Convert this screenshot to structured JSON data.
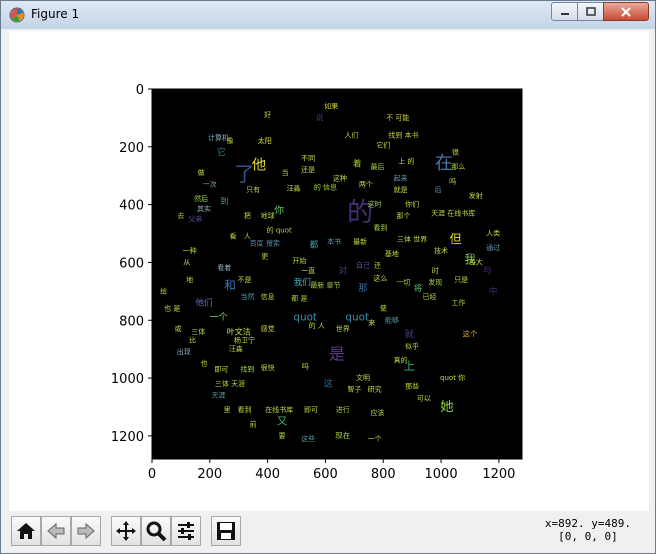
{
  "window": {
    "title": "Figure 1"
  },
  "toolbar": {
    "home": "home-icon",
    "back": "back-icon",
    "forward": "forward-icon",
    "pan": "pan-icon",
    "zoom": "zoom-icon",
    "configure": "configure-subplots-icon",
    "save": "save-icon",
    "coords_line1": "x=892. y=489.",
    "coords_line2": "[0, 0, 0]"
  },
  "chart_data": {
    "type": "wordcloud-image",
    "xlim": [
      0,
      1280
    ],
    "ylim": [
      1280,
      0
    ],
    "xticks": [
      0,
      200,
      400,
      600,
      800,
      1000,
      1200
    ],
    "yticks": [
      0,
      200,
      400,
      600,
      800,
      1000,
      1200
    ],
    "background": "#000000",
    "words": [
      {
        "t": "的",
        "x": 720,
        "y": 430,
        "s": 90,
        "c": "#44307a"
      },
      {
        "t": "了",
        "x": 320,
        "y": 300,
        "s": 70,
        "c": "#3b528b"
      },
      {
        "t": "在",
        "x": 1010,
        "y": 260,
        "s": 62,
        "c": "#4a78a4"
      },
      {
        "t": "他",
        "x": 370,
        "y": 265,
        "s": 50,
        "c": "#e0d82a"
      },
      {
        "t": "是",
        "x": 640,
        "y": 920,
        "s": 55,
        "c": "#5a3c8c"
      },
      {
        "t": "quot",
        "x": 530,
        "y": 790,
        "s": 36,
        "c": "#3c8fa8"
      },
      {
        "t": "quot",
        "x": 710,
        "y": 790,
        "s": 36,
        "c": "#3c8fa8"
      },
      {
        "t": "她",
        "x": 1020,
        "y": 1100,
        "s": 46,
        "c": "#8fd445"
      },
      {
        "t": "但",
        "x": 1050,
        "y": 520,
        "s": 42,
        "c": "#e0e020"
      },
      {
        "t": "你",
        "x": 440,
        "y": 420,
        "s": 34,
        "c": "#66c060"
      },
      {
        "t": "我",
        "x": 1100,
        "y": 590,
        "s": 40,
        "c": "#6ece58"
      },
      {
        "t": "我们",
        "x": 520,
        "y": 670,
        "s": 30,
        "c": "#4fa8c0"
      },
      {
        "t": "和",
        "x": 270,
        "y": 680,
        "s": 40,
        "c": "#3b7abf"
      },
      {
        "t": "他们",
        "x": 180,
        "y": 740,
        "s": 30,
        "c": "#5b6ec0"
      },
      {
        "t": "一个",
        "x": 230,
        "y": 790,
        "s": 32,
        "c": "#7bd060"
      },
      {
        "t": "叶文洁",
        "x": 300,
        "y": 840,
        "s": 28,
        "c": "#c8e030"
      },
      {
        "t": "着",
        "x": 710,
        "y": 260,
        "s": 30,
        "c": "#a8d838"
      },
      {
        "t": "说",
        "x": 580,
        "y": 100,
        "s": 26,
        "c": "#5c2f8a"
      },
      {
        "t": "就",
        "x": 890,
        "y": 850,
        "s": 34,
        "c": "#4b3d8a"
      },
      {
        "t": "将",
        "x": 920,
        "y": 690,
        "s": 30,
        "c": "#4fc070"
      },
      {
        "t": "都",
        "x": 560,
        "y": 540,
        "s": 30,
        "c": "#4d9ab8"
      },
      {
        "t": "对",
        "x": 660,
        "y": 630,
        "s": 30,
        "c": "#413e8a"
      },
      {
        "t": "那",
        "x": 730,
        "y": 690,
        "s": 32,
        "c": "#3a6fa0"
      },
      {
        "t": "这",
        "x": 610,
        "y": 1020,
        "s": 32,
        "c": "#2e6f8e"
      },
      {
        "t": "上",
        "x": 890,
        "y": 960,
        "s": 40,
        "c": "#27ad81"
      },
      {
        "t": "又",
        "x": 450,
        "y": 1150,
        "s": 36,
        "c": "#4fae70"
      },
      {
        "t": "它",
        "x": 240,
        "y": 220,
        "s": 32,
        "c": "#26828e"
      },
      {
        "t": "到",
        "x": 250,
        "y": 390,
        "s": 28,
        "c": "#5b9ab0"
      },
      {
        "t": "中",
        "x": 1180,
        "y": 700,
        "s": 30,
        "c": "#4a2c7a"
      },
      {
        "t": "与",
        "x": 1160,
        "y": 630,
        "s": 32,
        "c": "#482a78"
      },
      {
        "t": "这个",
        "x": 1100,
        "y": 850,
        "s": 26,
        "c": "#e0b020"
      },
      {
        "t": "现在",
        "x": 660,
        "y": 1200,
        "s": 26,
        "c": "#b0d848"
      },
      {
        "t": "太阳",
        "x": 390,
        "y": 180,
        "s": 22,
        "c": "#e0e040"
      },
      {
        "t": "汪淼",
        "x": 490,
        "y": 345,
        "s": 22,
        "c": "#c8e040"
      },
      {
        "t": "如果",
        "x": 620,
        "y": 60,
        "s": 18,
        "c": "#d0d040"
      },
      {
        "t": "不 可能",
        "x": 850,
        "y": 100,
        "s": 18,
        "c": "#d0d040"
      },
      {
        "t": "好",
        "x": 400,
        "y": 90,
        "s": 18,
        "c": "#aad840"
      },
      {
        "t": "人们",
        "x": 690,
        "y": 160,
        "s": 18,
        "c": "#d0d040"
      },
      {
        "t": "找到 本书",
        "x": 870,
        "y": 160,
        "s": 18,
        "c": "#d0d040"
      },
      {
        "t": "很",
        "x": 1050,
        "y": 220,
        "s": 22,
        "c": "#c8d840"
      },
      {
        "t": "计算机",
        "x": 230,
        "y": 170,
        "s": 18,
        "c": "#8ab0c0"
      },
      {
        "t": "做",
        "x": 170,
        "y": 290,
        "s": 20,
        "c": "#c8d840"
      },
      {
        "t": "一次",
        "x": 200,
        "y": 330,
        "s": 18,
        "c": "#8ab0c0"
      },
      {
        "t": "然后",
        "x": 170,
        "y": 380,
        "s": 18,
        "c": "#aad840"
      },
      {
        "t": "其实",
        "x": 180,
        "y": 415,
        "s": 18,
        "c": "#8ab0c0"
      },
      {
        "t": "父亲",
        "x": 150,
        "y": 450,
        "s": 18,
        "c": "#5a4a9a"
      },
      {
        "t": "把",
        "x": 330,
        "y": 440,
        "s": 20,
        "c": "#d8d840"
      },
      {
        "t": "地球",
        "x": 400,
        "y": 440,
        "s": 18,
        "c": "#aad840"
      },
      {
        "t": "看",
        "x": 280,
        "y": 510,
        "s": 20,
        "c": "#c8d840"
      },
      {
        "t": "百度 搜索",
        "x": 390,
        "y": 535,
        "s": 18,
        "c": "#5a8aaa"
      },
      {
        "t": "一种",
        "x": 130,
        "y": 560,
        "s": 18,
        "c": "#aad840"
      },
      {
        "t": "更",
        "x": 390,
        "y": 580,
        "s": 18,
        "c": "#aad840"
      },
      {
        "t": "开始",
        "x": 510,
        "y": 595,
        "s": 18,
        "c": "#aad840"
      },
      {
        "t": "看着",
        "x": 250,
        "y": 620,
        "s": 18,
        "c": "#8ab0c0"
      },
      {
        "t": "一直",
        "x": 540,
        "y": 630,
        "s": 18,
        "c": "#c8d840"
      },
      {
        "t": "不是",
        "x": 320,
        "y": 660,
        "s": 20,
        "c": "#c8d840"
      },
      {
        "t": "地",
        "x": 130,
        "y": 660,
        "s": 22,
        "c": "#c8d840"
      },
      {
        "t": "给",
        "x": 40,
        "y": 700,
        "s": 20,
        "c": "#c8d840"
      },
      {
        "t": "也 是",
        "x": 70,
        "y": 760,
        "s": 18,
        "c": "#c8d840"
      },
      {
        "t": "当然",
        "x": 330,
        "y": 720,
        "s": 18,
        "c": "#5a9aaa"
      },
      {
        "t": "信息",
        "x": 400,
        "y": 720,
        "s": 18,
        "c": "#c8d840"
      },
      {
        "t": "最新 章节",
        "x": 600,
        "y": 680,
        "s": 18,
        "c": "#aad840"
      },
      {
        "t": "这么",
        "x": 790,
        "y": 655,
        "s": 20,
        "c": "#d8d840"
      },
      {
        "t": "一切",
        "x": 870,
        "y": 670,
        "s": 18,
        "c": "#aad840"
      },
      {
        "t": "发现",
        "x": 980,
        "y": 670,
        "s": 18,
        "c": "#aad840"
      },
      {
        "t": "已经",
        "x": 960,
        "y": 720,
        "s": 18,
        "c": "#c8d840"
      },
      {
        "t": "工作",
        "x": 1060,
        "y": 740,
        "s": 18,
        "c": "#aad840"
      },
      {
        "t": "三体",
        "x": 160,
        "y": 840,
        "s": 18,
        "c": "#c8d840"
      },
      {
        "t": "或",
        "x": 90,
        "y": 830,
        "s": 18,
        "c": "#c8d840"
      },
      {
        "t": "比",
        "x": 140,
        "y": 870,
        "s": 18,
        "c": "#c8d840"
      },
      {
        "t": "杨卫宁",
        "x": 320,
        "y": 870,
        "s": 18,
        "c": "#c8d840"
      },
      {
        "t": "感觉",
        "x": 400,
        "y": 830,
        "s": 18,
        "c": "#d8d840"
      },
      {
        "t": "世界",
        "x": 660,
        "y": 830,
        "s": 18,
        "c": "#c8d840"
      },
      {
        "t": "来",
        "x": 760,
        "y": 810,
        "s": 20,
        "c": "#d8d840"
      },
      {
        "t": "能够",
        "x": 830,
        "y": 800,
        "s": 18,
        "c": "#5a9aaa"
      },
      {
        "t": "汪淼",
        "x": 290,
        "y": 900,
        "s": 18,
        "c": "#c8d840"
      },
      {
        "t": "出现",
        "x": 110,
        "y": 910,
        "s": 18,
        "c": "#8ab0c0"
      },
      {
        "t": "也",
        "x": 180,
        "y": 950,
        "s": 22,
        "c": "#c8d840"
      },
      {
        "t": "即可",
        "x": 240,
        "y": 970,
        "s": 18,
        "c": "#c8d840"
      },
      {
        "t": "找到",
        "x": 330,
        "y": 970,
        "s": 18,
        "c": "#aad840"
      },
      {
        "t": "很快",
        "x": 400,
        "y": 965,
        "s": 18,
        "c": "#c8d840"
      },
      {
        "t": "三体 天涯",
        "x": 270,
        "y": 1020,
        "s": 18,
        "c": "#c8d840"
      },
      {
        "t": "天涯",
        "x": 230,
        "y": 1060,
        "s": 18,
        "c": "#5a9aaa"
      },
      {
        "t": "里",
        "x": 260,
        "y": 1110,
        "s": 18,
        "c": "#c8d840"
      },
      {
        "t": "看到",
        "x": 320,
        "y": 1110,
        "s": 18,
        "c": "#c8d840"
      },
      {
        "t": "在线书库",
        "x": 440,
        "y": 1110,
        "s": 18,
        "c": "#c8d840"
      },
      {
        "t": "即可",
        "x": 550,
        "y": 1110,
        "s": 18,
        "c": "#c8d840"
      },
      {
        "t": "进行",
        "x": 660,
        "y": 1110,
        "s": 18,
        "c": "#aad840"
      },
      {
        "t": "应该",
        "x": 780,
        "y": 1120,
        "s": 18,
        "c": "#aad840"
      },
      {
        "t": "前",
        "x": 350,
        "y": 1160,
        "s": 18,
        "c": "#aad840"
      },
      {
        "t": "要",
        "x": 450,
        "y": 1200,
        "s": 18,
        "c": "#aad840"
      },
      {
        "t": "这些",
        "x": 540,
        "y": 1210,
        "s": 18,
        "c": "#5a9aaa"
      },
      {
        "t": "一个",
        "x": 770,
        "y": 1210,
        "s": 18,
        "c": "#c8d840"
      },
      {
        "t": "文明",
        "x": 730,
        "y": 1000,
        "s": 18,
        "c": "#c8d840"
      },
      {
        "t": "智子",
        "x": 700,
        "y": 1040,
        "s": 18,
        "c": "#c8d840"
      },
      {
        "t": "研究",
        "x": 770,
        "y": 1040,
        "s": 18,
        "c": "#c8d840"
      },
      {
        "t": "那些",
        "x": 900,
        "y": 1030,
        "s": 18,
        "c": "#c8d840"
      },
      {
        "t": "可以",
        "x": 940,
        "y": 1070,
        "s": 18,
        "c": "#c8d840"
      },
      {
        "t": "quot 你",
        "x": 1040,
        "y": 1000,
        "s": 18,
        "c": "#c8d840"
      },
      {
        "t": "真的",
        "x": 860,
        "y": 940,
        "s": 18,
        "c": "#c8d840"
      },
      {
        "t": "似乎",
        "x": 900,
        "y": 890,
        "s": 18,
        "c": "#c8d840"
      },
      {
        "t": "三体 世界",
        "x": 900,
        "y": 520,
        "s": 18,
        "c": "#c8d840"
      },
      {
        "t": "基地",
        "x": 830,
        "y": 570,
        "s": 18,
        "c": "#c8d840"
      },
      {
        "t": "技术",
        "x": 1000,
        "y": 560,
        "s": 18,
        "c": "#c8d840"
      },
      {
        "t": "人类",
        "x": 1180,
        "y": 500,
        "s": 18,
        "c": "#c8d840"
      },
      {
        "t": "通过",
        "x": 1180,
        "y": 550,
        "s": 18,
        "c": "#5a9aaa"
      },
      {
        "t": "只是",
        "x": 1070,
        "y": 660,
        "s": 18,
        "c": "#c8d840"
      },
      {
        "t": "在线书库",
        "x": 1070,
        "y": 430,
        "s": 18,
        "c": "#c8d840"
      },
      {
        "t": "天涯",
        "x": 990,
        "y": 430,
        "s": 18,
        "c": "#c8d840"
      },
      {
        "t": "发射",
        "x": 1120,
        "y": 370,
        "s": 18,
        "c": "#c8d840"
      },
      {
        "t": "巨大",
        "x": 1120,
        "y": 600,
        "s": 18,
        "c": "#c8d840"
      },
      {
        "t": "那么",
        "x": 1060,
        "y": 270,
        "s": 18,
        "c": "#aad840"
      },
      {
        "t": "吗",
        "x": 1040,
        "y": 320,
        "s": 18,
        "c": "#c8d840"
      },
      {
        "t": "后",
        "x": 990,
        "y": 350,
        "s": 22,
        "c": "#5a9aaa"
      },
      {
        "t": "就是",
        "x": 860,
        "y": 350,
        "s": 20,
        "c": "#c8d840"
      },
      {
        "t": "起来",
        "x": 860,
        "y": 310,
        "s": 18,
        "c": "#5a9aaa"
      },
      {
        "t": "你们",
        "x": 900,
        "y": 400,
        "s": 18,
        "c": "#c8d840"
      },
      {
        "t": "那个",
        "x": 870,
        "y": 440,
        "s": 18,
        "c": "#c8d840"
      },
      {
        "t": "看到",
        "x": 790,
        "y": 480,
        "s": 18,
        "c": "#aad840"
      },
      {
        "t": "这时",
        "x": 770,
        "y": 400,
        "s": 18,
        "c": "#aad840"
      },
      {
        "t": "两个",
        "x": 740,
        "y": 330,
        "s": 18,
        "c": "#c8d840"
      },
      {
        "t": "这种",
        "x": 650,
        "y": 310,
        "s": 18,
        "c": "#c8d840"
      },
      {
        "t": "的 信息",
        "x": 600,
        "y": 340,
        "s": 18,
        "c": "#aad840"
      },
      {
        "t": "还是",
        "x": 540,
        "y": 280,
        "s": 18,
        "c": "#c8d840"
      },
      {
        "t": "当",
        "x": 460,
        "y": 290,
        "s": 18,
        "c": "#c8d840"
      },
      {
        "t": "只有",
        "x": 350,
        "y": 350,
        "s": 18,
        "c": "#aad840"
      },
      {
        "t": "像",
        "x": 270,
        "y": 180,
        "s": 18,
        "c": "#c8d840"
      },
      {
        "t": "最后",
        "x": 780,
        "y": 270,
        "s": 18,
        "c": "#aad840"
      },
      {
        "t": "上 的",
        "x": 880,
        "y": 250,
        "s": 18,
        "c": "#c8d840"
      },
      {
        "t": "它们",
        "x": 800,
        "y": 195,
        "s": 18,
        "c": "#c8d840"
      },
      {
        "t": "的 quot",
        "x": 440,
        "y": 490,
        "s": 18,
        "c": "#aad840"
      },
      {
        "t": "本书",
        "x": 630,
        "y": 530,
        "s": 18,
        "c": "#5a9aaa"
      },
      {
        "t": "最新",
        "x": 720,
        "y": 530,
        "s": 18,
        "c": "#c8d840"
      },
      {
        "t": "自己",
        "x": 730,
        "y": 610,
        "s": 18,
        "c": "#6a4aa0"
      },
      {
        "t": "还",
        "x": 780,
        "y": 610,
        "s": 18,
        "c": "#aad840"
      },
      {
        "t": "时",
        "x": 980,
        "y": 630,
        "s": 22,
        "c": "#c8d840"
      },
      {
        "t": "使",
        "x": 800,
        "y": 760,
        "s": 18,
        "c": "#c8d840"
      },
      {
        "t": "吗",
        "x": 530,
        "y": 960,
        "s": 18,
        "c": "#c8d840"
      },
      {
        "t": "的 人",
        "x": 570,
        "y": 820,
        "s": 18,
        "c": "#aad840"
      },
      {
        "t": "人",
        "x": 330,
        "y": 510,
        "s": 18,
        "c": "#aad840"
      },
      {
        "t": "从",
        "x": 120,
        "y": 600,
        "s": 22,
        "c": "#c8d840"
      },
      {
        "t": "去",
        "x": 100,
        "y": 440,
        "s": 18,
        "c": "#aad840"
      },
      {
        "t": "不同",
        "x": 540,
        "y": 240,
        "s": 18,
        "c": "#c8d840"
      },
      {
        "t": "都 是",
        "x": 510,
        "y": 725,
        "s": 18,
        "c": "#aad840"
      }
    ]
  }
}
